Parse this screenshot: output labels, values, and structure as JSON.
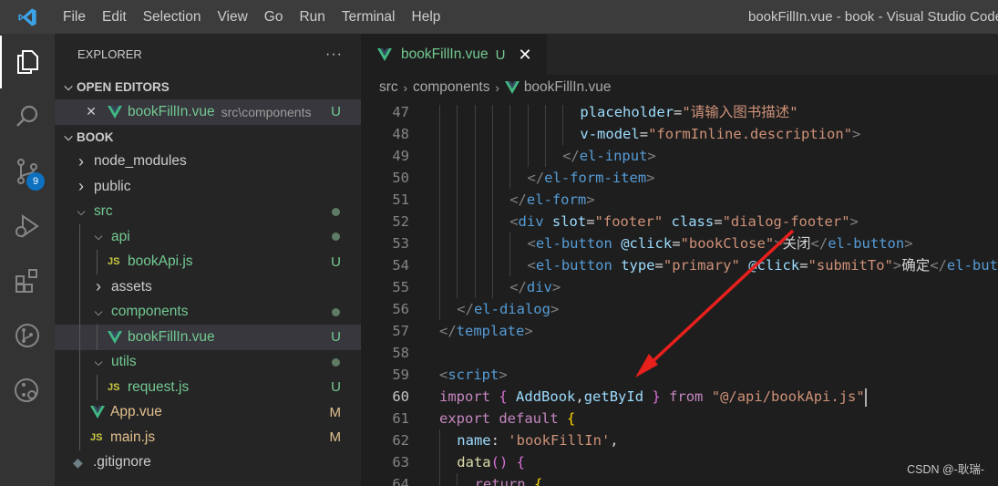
{
  "titlebar": {
    "menu": [
      "File",
      "Edit",
      "Selection",
      "View",
      "Go",
      "Run",
      "Terminal",
      "Help"
    ],
    "window_title": "bookFillIn.vue - book - Visual Studio Code"
  },
  "activitybar": {
    "icons": [
      "explorer-icon",
      "search-icon",
      "source-control-icon",
      "run-debug-icon",
      "extensions-icon",
      "git-graph-icon",
      "remote-icon"
    ],
    "scm_badge": "9"
  },
  "sidebar": {
    "title": "EXPLORER",
    "more": "···",
    "open_editors": {
      "label": "OPEN EDITORS",
      "items": [
        {
          "name": "bookFillIn.vue",
          "path": "src\\components",
          "status": "U"
        }
      ]
    },
    "workspace": {
      "label": "BOOK",
      "tree": [
        {
          "label": "node_modules",
          "kind": "folder-closed",
          "level": 0
        },
        {
          "label": "public",
          "kind": "folder-closed",
          "level": 0
        },
        {
          "label": "src",
          "kind": "folder-open",
          "level": 0
        },
        {
          "label": "api",
          "kind": "folder-open",
          "level": 1
        },
        {
          "label": "bookApi.js",
          "kind": "js",
          "level": 2,
          "status": "U"
        },
        {
          "label": "assets",
          "kind": "folder-closed",
          "level": 1
        },
        {
          "label": "components",
          "kind": "folder-open",
          "level": 1
        },
        {
          "label": "bookFillIn.vue",
          "kind": "vue",
          "level": 2,
          "status": "U"
        },
        {
          "label": "utils",
          "kind": "folder-open",
          "level": 1
        },
        {
          "label": "request.js",
          "kind": "js",
          "level": 2,
          "status": "U"
        },
        {
          "label": "App.vue",
          "kind": "vue",
          "level": 1,
          "status": "M"
        },
        {
          "label": "main.js",
          "kind": "js",
          "level": 1,
          "status": "M"
        },
        {
          "label": ".gitignore",
          "kind": "git",
          "level": 0
        }
      ]
    }
  },
  "editor": {
    "tab": {
      "label": "bookFillIn.vue",
      "status": "U",
      "close": "✕"
    },
    "breadcrumb": [
      "src",
      "components",
      "bookFillIn.vue"
    ],
    "lines": [
      {
        "n": "47",
        "indent": 8,
        "tokens": [
          [
            "placeholder",
            "t-attr"
          ],
          [
            "=",
            "t-txt"
          ],
          [
            "\"请输入图书描述\"",
            "t-str"
          ]
        ]
      },
      {
        "n": "48",
        "indent": 8,
        "tokens": [
          [
            "v-model",
            "t-attr"
          ],
          [
            "=",
            "t-txt"
          ],
          [
            "\"formInline.description\"",
            "t-str"
          ],
          [
            ">",
            "t-tag"
          ]
        ]
      },
      {
        "n": "49",
        "indent": 7,
        "tokens": [
          [
            "</",
            "t-tag"
          ],
          [
            "el-input",
            "t-name"
          ],
          [
            ">",
            "t-tag"
          ]
        ]
      },
      {
        "n": "50",
        "indent": 5,
        "tokens": [
          [
            "</",
            "t-tag"
          ],
          [
            "el-form-item",
            "t-name"
          ],
          [
            ">",
            "t-tag"
          ]
        ]
      },
      {
        "n": "51",
        "indent": 4,
        "tokens": [
          [
            "</",
            "t-tag"
          ],
          [
            "el-form",
            "t-name"
          ],
          [
            ">",
            "t-tag"
          ]
        ]
      },
      {
        "n": "52",
        "indent": 4,
        "tokens": [
          [
            "<",
            "t-tag"
          ],
          [
            "div",
            "t-name"
          ],
          [
            " ",
            "t-txt"
          ],
          [
            "slot",
            "t-attr"
          ],
          [
            "=",
            "t-txt"
          ],
          [
            "\"footer\"",
            "t-str"
          ],
          [
            " ",
            "t-txt"
          ],
          [
            "class",
            "t-attr"
          ],
          [
            "=",
            "t-txt"
          ],
          [
            "\"dialog-footer\"",
            "t-str"
          ],
          [
            ">",
            "t-tag"
          ]
        ]
      },
      {
        "n": "53",
        "indent": 5,
        "tokens": [
          [
            "<",
            "t-tag"
          ],
          [
            "el-button",
            "t-name"
          ],
          [
            " ",
            "t-txt"
          ],
          [
            "@click",
            "t-attr"
          ],
          [
            "=",
            "t-txt"
          ],
          [
            "\"bookClose\"",
            "t-str"
          ],
          [
            ">",
            "t-tag"
          ],
          [
            "关闭",
            "t-txt"
          ],
          [
            "</",
            "t-tag"
          ],
          [
            "el-button",
            "t-name"
          ],
          [
            ">",
            "t-tag"
          ]
        ]
      },
      {
        "n": "54",
        "indent": 5,
        "tokens": [
          [
            "<",
            "t-tag"
          ],
          [
            "el-button",
            "t-name"
          ],
          [
            " ",
            "t-txt"
          ],
          [
            "type",
            "t-attr"
          ],
          [
            "=",
            "t-txt"
          ],
          [
            "\"primary\"",
            "t-str"
          ],
          [
            " ",
            "t-txt"
          ],
          [
            "@click",
            "t-attr"
          ],
          [
            "=",
            "t-txt"
          ],
          [
            "\"submitTo\"",
            "t-str"
          ],
          [
            ">",
            "t-tag"
          ],
          [
            "确定",
            "t-txt"
          ],
          [
            "</",
            "t-tag"
          ],
          [
            "el-butto",
            "t-name"
          ]
        ]
      },
      {
        "n": "55",
        "indent": 4,
        "tokens": [
          [
            "</",
            "t-tag"
          ],
          [
            "div",
            "t-name"
          ],
          [
            ">",
            "t-tag"
          ]
        ]
      },
      {
        "n": "56",
        "indent": 1,
        "tokens": [
          [
            "</",
            "t-tag"
          ],
          [
            "el-dialog",
            "t-name"
          ],
          [
            ">",
            "t-tag"
          ]
        ]
      },
      {
        "n": "57",
        "indent": 0,
        "tokens": [
          [
            "</",
            "t-tag"
          ],
          [
            "template",
            "t-name"
          ],
          [
            ">",
            "t-tag"
          ]
        ]
      },
      {
        "n": "58",
        "indent": 0,
        "tokens": []
      },
      {
        "n": "59",
        "indent": 0,
        "tokens": [
          [
            "<",
            "t-tag"
          ],
          [
            "script",
            "t-name"
          ],
          [
            ">",
            "t-tag"
          ]
        ]
      },
      {
        "n": "60",
        "indent": 0,
        "current": true,
        "tokens": [
          [
            "import",
            "t-kw"
          ],
          [
            " ",
            "t-txt"
          ],
          [
            "{",
            "t-br2"
          ],
          [
            " ",
            "t-txt"
          ],
          [
            "AddBook",
            "t-var"
          ],
          [
            ",",
            "t-txt"
          ],
          [
            "getById",
            "t-var"
          ],
          [
            " ",
            "t-txt"
          ],
          [
            "}",
            "t-br2"
          ],
          [
            " ",
            "t-txt"
          ],
          [
            "from",
            "t-kw"
          ],
          [
            " ",
            "t-txt"
          ],
          [
            "\"@/api/bookApi.js\"",
            "t-str"
          ]
        ]
      },
      {
        "n": "61",
        "indent": 0,
        "tokens": [
          [
            "export",
            "t-kw"
          ],
          [
            " ",
            "t-txt"
          ],
          [
            "default",
            "t-kw"
          ],
          [
            " ",
            "t-txt"
          ],
          [
            "{",
            "t-br"
          ]
        ]
      },
      {
        "n": "62",
        "indent": 1,
        "tokens": [
          [
            "name",
            "t-var"
          ],
          [
            ": ",
            "t-txt"
          ],
          [
            "'bookFillIn'",
            "t-str"
          ],
          [
            ",",
            "t-txt"
          ]
        ]
      },
      {
        "n": "63",
        "indent": 1,
        "tokens": [
          [
            "data",
            "t-fn"
          ],
          [
            "()",
            "t-br2"
          ],
          [
            " ",
            "t-txt"
          ],
          [
            "{",
            "t-br2"
          ]
        ]
      },
      {
        "n": "64",
        "indent": 2,
        "tokens": [
          [
            "return",
            "t-kw"
          ],
          [
            " ",
            "t-txt"
          ],
          [
            "{",
            "t-br"
          ]
        ]
      }
    ]
  },
  "watermark": "CSDN @-耿瑞-"
}
